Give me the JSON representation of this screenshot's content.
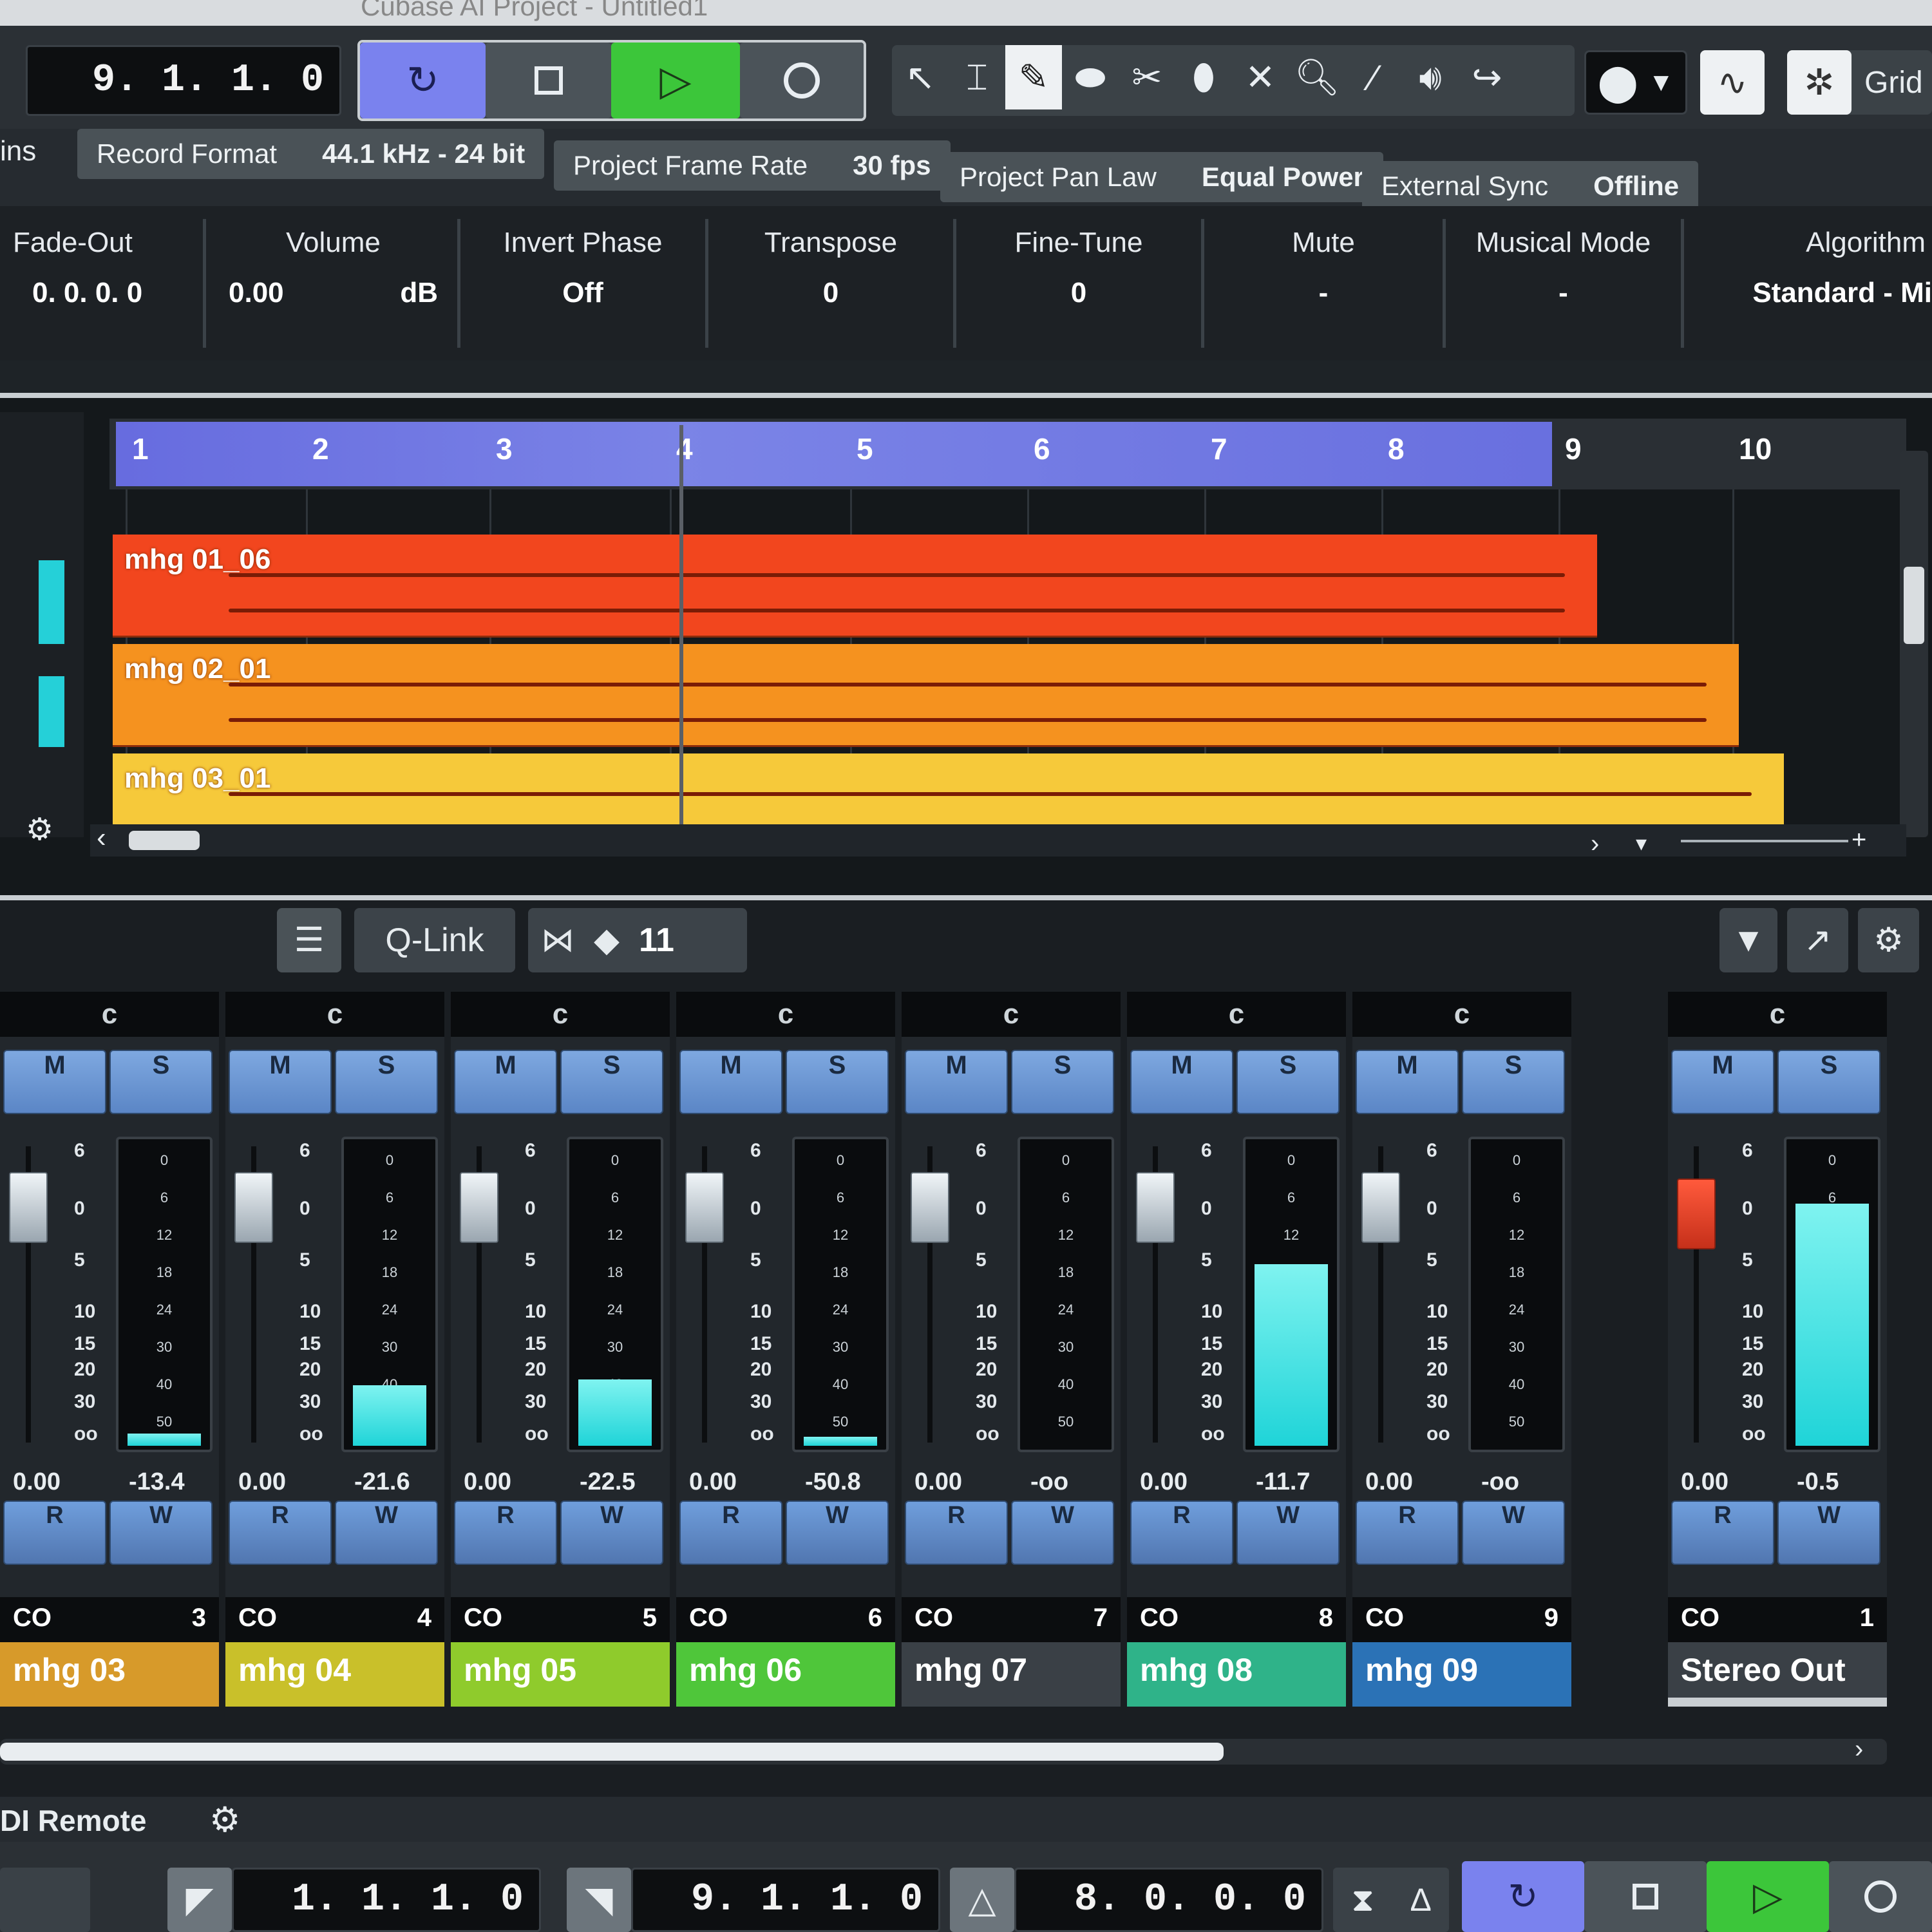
{
  "window_title": "Cubase AI Project - Untitled1",
  "transport": {
    "position": "9.  1.  1.   0",
    "tools": [
      "object-selection",
      "range-selection",
      "draw",
      "erase",
      "split",
      "glue",
      "delete",
      "zoom",
      "line",
      "mute",
      "comp"
    ],
    "grid_label": "Grid"
  },
  "status": {
    "left_cut": "ins",
    "record_format_label": "Record Format",
    "record_format_value": "44.1 kHz - 24 bit",
    "frame_rate_label": "Project Frame Rate",
    "frame_rate_value": "30 fps",
    "pan_law_label": "Project Pan Law",
    "pan_law_value": "Equal Power",
    "sync_label": "External Sync",
    "sync_value": "Offline"
  },
  "infoline": [
    {
      "label": "Fade-Out",
      "value": "0.  0.  0.   0"
    },
    {
      "label": "Volume",
      "value": "0.00",
      "unit": "dB"
    },
    {
      "label": "Invert Phase",
      "value": "Off"
    },
    {
      "label": "Transpose",
      "value": "0"
    },
    {
      "label": "Fine-Tune",
      "value": "0"
    },
    {
      "label": "Mute",
      "value": "-"
    },
    {
      "label": "Musical Mode",
      "value": "-"
    },
    {
      "label": "Algorithm",
      "value": "Standard - Mi"
    }
  ],
  "ruler_bars": [
    "1",
    "2",
    "3",
    "4",
    "5",
    "6",
    "7",
    "8",
    "9",
    "10"
  ],
  "events": [
    {
      "name": "mhg 01_06",
      "color": "#f2461e"
    },
    {
      "name": "mhg 02_01",
      "color": "#f5921f"
    },
    {
      "name": "mhg 03_01",
      "color": "#f6c93a"
    }
  ],
  "mixer_toolbar": {
    "qlink": "Q-Link",
    "visible_count": "11"
  },
  "channels": [
    {
      "number": "3",
      "name": "mhg 03",
      "fader": "0.00",
      "peak": "-13.4",
      "meter_level": 0.04,
      "color": "#d79a2a"
    },
    {
      "number": "4",
      "name": "mhg 04",
      "fader": "0.00",
      "peak": "-21.6",
      "meter_level": 0.2,
      "color": "#c9c02a"
    },
    {
      "number": "5",
      "name": "mhg 05",
      "fader": "0.00",
      "peak": "-22.5",
      "meter_level": 0.22,
      "color": "#8fcb2c"
    },
    {
      "number": "6",
      "name": "mhg 06",
      "fader": "0.00",
      "peak": "-50.8",
      "meter_level": 0.03,
      "color": "#4fc63a"
    },
    {
      "number": "7",
      "name": "mhg 07",
      "fader": "0.00",
      "peak": "-oo",
      "meter_level": 0.0,
      "color": "#3a4046"
    },
    {
      "number": "8",
      "name": "mhg 08",
      "fader": "0.00",
      "peak": "-11.7",
      "meter_level": 0.6,
      "color": "#2fb389"
    },
    {
      "number": "9",
      "name": "mhg 09",
      "fader": "0.00",
      "peak": "-oo",
      "meter_level": 0.0,
      "color": "#2b72b6"
    }
  ],
  "master": {
    "number": "1",
    "name": "Stereo Out",
    "fader": "0.00",
    "peak": "-0.5",
    "meter_level": 0.8
  },
  "fader_scale": [
    "6",
    "0",
    "5",
    "10",
    "15",
    "20",
    "30",
    "oo"
  ],
  "meter_scale": [
    "0",
    "6",
    "12",
    "18",
    "24",
    "30",
    "40",
    "50"
  ],
  "strip_labels": {
    "route": "c",
    "mute": "M",
    "solo": "S",
    "read": "R",
    "write": "W",
    "link": "CO"
  },
  "midi_remote": "DI Remote",
  "bottom": {
    "left_locator": "1.  1.  1.   0",
    "right_locator": "9.  1.  1.   0",
    "length": "8.  0.  0.   0"
  },
  "colors": {
    "cycle": "#6f76ea",
    "play": "#3bd23a",
    "accent_blue": "#5b86c6"
  }
}
